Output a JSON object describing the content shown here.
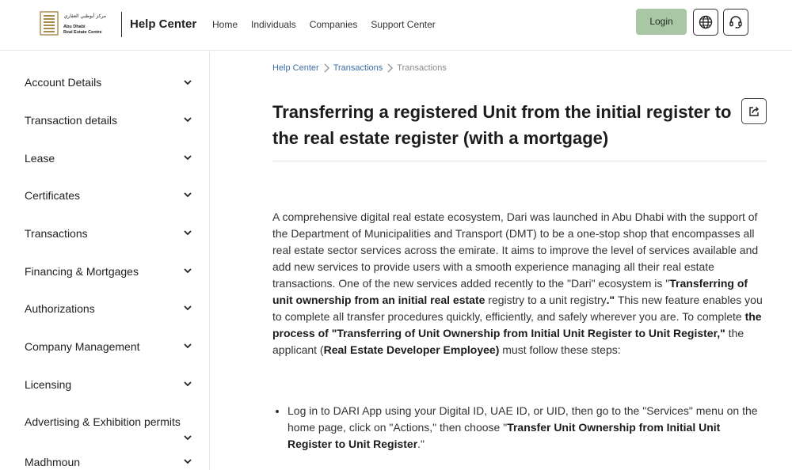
{
  "header": {
    "logo": {
      "arabic_text": "مركز أبوظبي العقاري",
      "english_line1": "Abu Dhabi",
      "english_line2": "Real Estate Centre"
    },
    "title": "Help Center",
    "nav": [
      "Home",
      "Individuals",
      "Companies",
      "Support Center"
    ],
    "login_label": "Login",
    "accent_color": "#a9c7a5"
  },
  "sidebar": {
    "items": [
      {
        "label": "Account Details"
      },
      {
        "label": "Transaction details"
      },
      {
        "label": "Lease"
      },
      {
        "label": "Certificates"
      },
      {
        "label": "Transactions"
      },
      {
        "label": "Financing & Mortgages"
      },
      {
        "label": "Authorizations"
      },
      {
        "label": "Company Management"
      },
      {
        "label": "Licensing"
      },
      {
        "label": "Advertising & Exhibition permits"
      },
      {
        "label": "Madhmoun"
      }
    ]
  },
  "breadcrumb": {
    "items": [
      "Help Center",
      "Transactions",
      "Transactions"
    ]
  },
  "article": {
    "title": "Transferring a registered Unit from the initial register to the real estate register (with a mortgage)",
    "paragraph": {
      "t1": "A comprehensive digital real estate ecosystem, Dari was launched in Abu Dhabi with the support of the Department of Municipalities and Transport (DMT) to be a one-stop shop that encompasses all real estate sector services across the emirate. It aims to improve the level of services available and add new services to provide users with a smooth experience managing all their real estate transactions. One of the new services added recently to the \"Dari\" ecosystem is \"",
      "b1": "Transferring of unit ownership from an initial real estate",
      "t2": " registry to a unit registry",
      "b2": ".\"",
      "t3": " This new feature enables you to complete all transfer procedures quickly, efficiently, and safely wherever you are. To complete ",
      "b3": "the process of \"Transferring of Unit Ownership from Initial Unit Register to Unit Register,\"",
      "t4": " the applicant (",
      "b4": "Real Estate Developer Employee)",
      "t5": " must follow these steps:"
    },
    "steps": [
      {
        "t1": "Log in to DARI App using your Digital ID, UAE ID, or UID, then go to the \"Services\" menu on the home page, click on \"Actions,\" then choose \"",
        "b1": "Transfer Unit Ownership from Initial Unit Register to Unit Register",
        "t2": ".\""
      }
    ]
  }
}
